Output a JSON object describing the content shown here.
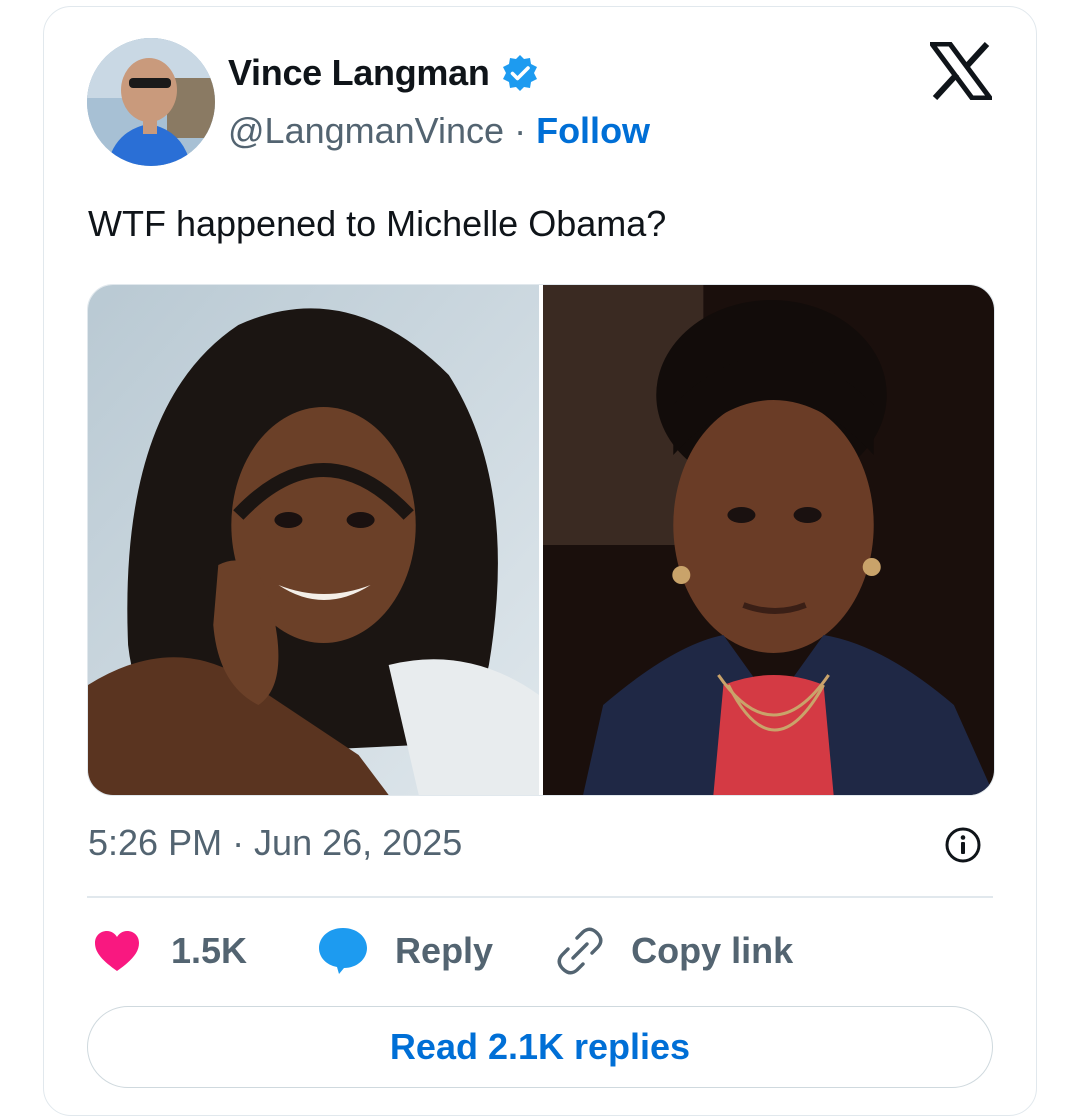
{
  "author": {
    "name": "Vince Langman",
    "handle": "@LangmanVince",
    "separator": "·",
    "follow_label": "Follow",
    "verified": true,
    "avatar_icon": "profile-photo"
  },
  "brand": {
    "logo_icon": "x-logo-icon"
  },
  "tweet": {
    "text": "WTF happened to Michelle Obama?",
    "timestamp": "5:26 PM · Jun 26, 2025",
    "media": [
      {
        "name": "photo-left",
        "description_icon": "portrait-photo"
      },
      {
        "name": "photo-right",
        "description_icon": "portrait-photo"
      }
    ]
  },
  "actions": {
    "like_count": "1.5K",
    "reply_label": "Reply",
    "copy_label": "Copy link"
  },
  "read_replies_label": "Read 2.1K replies",
  "colors": {
    "accent": "#006fd6",
    "verified": "#1d9bf0",
    "like": "#f91880",
    "reply": "#1d9bf0",
    "text": "#0f1419",
    "muted": "#536471",
    "border": "#e1e8ed"
  }
}
